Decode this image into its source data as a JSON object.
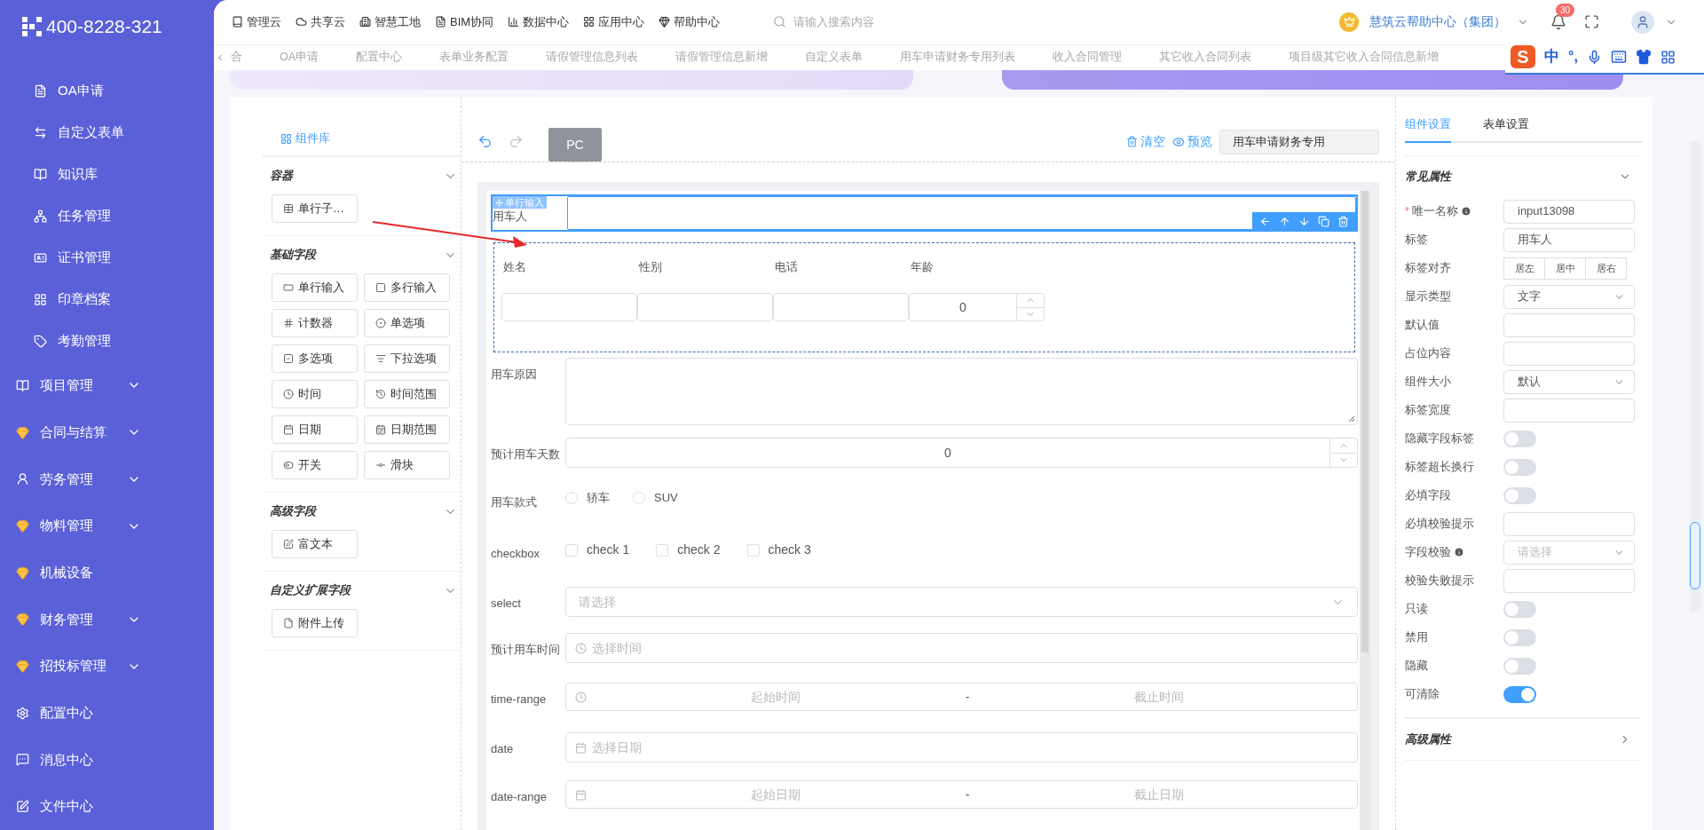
{
  "header": {
    "phone": "400-8228-321",
    "nav": [
      {
        "label": "管理云",
        "kind": "book"
      },
      {
        "label": "共享云",
        "kind": "cloud"
      },
      {
        "label": "智慧工地",
        "kind": "building"
      },
      {
        "label": "BIM协同",
        "kind": "doc"
      },
      {
        "label": "数据中心",
        "kind": "chart"
      },
      {
        "label": "应用中心",
        "kind": "apps"
      },
      {
        "label": "帮助中心",
        "kind": "gem"
      }
    ],
    "search": {
      "placeholder": "请输入搜索内容"
    },
    "org": "慧筑云帮助中心（集团）",
    "notifications": "30"
  },
  "tabs": [
    {
      "label": "合",
      "selected": false
    },
    {
      "label": "OA申请",
      "selected": false
    },
    {
      "label": "配置中心",
      "selected": false
    },
    {
      "label": "表单业务配置",
      "selected": false
    },
    {
      "label": "请假管理信息列表",
      "selected": false
    },
    {
      "label": "请假管理信息新增",
      "selected": false
    },
    {
      "label": "自定义表单",
      "selected": false
    },
    {
      "label": "用车申请财务专用列表",
      "selected": false
    },
    {
      "label": "收入合同管理",
      "selected": false
    },
    {
      "label": "其它收入合同列表",
      "selected": false
    },
    {
      "label": "项目级其它收入合同信息新增",
      "selected": false
    }
  ],
  "ime_bar": {
    "logo": "S",
    "mode": "中",
    "punct": "°,"
  },
  "sidebar": {
    "sub_items": [
      {
        "label": "OA申请",
        "kind": "file"
      },
      {
        "label": "自定义表单",
        "kind": "swap"
      },
      {
        "label": "知识库",
        "kind": "book"
      },
      {
        "label": "任务管理",
        "kind": "tree"
      },
      {
        "label": "证书管理",
        "kind": "card"
      },
      {
        "label": "印章档案",
        "kind": "grid"
      },
      {
        "label": "考勤管理",
        "kind": "tag"
      }
    ],
    "items": [
      {
        "label": "项目管理",
        "kind": "book",
        "expandable": true
      },
      {
        "label": "合同与结算",
        "kind": "gem",
        "expandable": true
      },
      {
        "label": "劳务管理",
        "kind": "user",
        "expandable": true
      },
      {
        "label": "物料管理",
        "kind": "gem",
        "expandable": true
      },
      {
        "label": "机械设备",
        "kind": "gem",
        "expandable": false
      },
      {
        "label": "财务管理",
        "kind": "gem",
        "expandable": true
      },
      {
        "label": "招投标管理",
        "kind": "gem",
        "expandable": true
      },
      {
        "label": "配置中心",
        "kind": "gear",
        "expandable": false
      },
      {
        "label": "消息中心",
        "kind": "chat",
        "expandable": false
      },
      {
        "label": "文件中心",
        "kind": "edit",
        "expandable": false
      }
    ]
  },
  "library": {
    "title": "组件库",
    "groups": [
      {
        "title": "容器",
        "expanded": true,
        "components": [
          {
            "label": "单行子…",
            "kind": "grid"
          }
        ]
      },
      {
        "title": "基础字段",
        "expanded": true,
        "components": [
          {
            "label": "单行输入",
            "kind": "input"
          },
          {
            "label": "多行输入",
            "kind": "textarea"
          },
          {
            "label": "计数器",
            "kind": "number"
          },
          {
            "label": "单选项",
            "kind": "radio"
          },
          {
            "label": "多选项",
            "kind": "checkbox"
          },
          {
            "label": "下拉选项",
            "kind": "select"
          },
          {
            "label": "时间",
            "kind": "time"
          },
          {
            "label": "时间范围",
            "kind": "time-range"
          },
          {
            "label": "日期",
            "kind": "date"
          },
          {
            "label": "日期范围",
            "kind": "date-range"
          },
          {
            "label": "开关",
            "kind": "switch"
          },
          {
            "label": "滑块",
            "kind": "slider"
          }
        ]
      },
      {
        "title": "高级字段",
        "expanded": true,
        "components": [
          {
            "label": "富文本",
            "kind": "richtext"
          }
        ]
      },
      {
        "title": "自定义扩展字段",
        "expanded": true,
        "components": [
          {
            "label": "附件上传",
            "kind": "upload"
          }
        ]
      }
    ]
  },
  "canvas": {
    "device": "PC",
    "clear": "清空",
    "preview": "预览",
    "form_name": "用车申请财务专用",
    "selected_tag": "单行输入",
    "fields": [
      {
        "kind": "input",
        "label": "用车人",
        "selected": true
      },
      {
        "kind": "grid",
        "selected": false,
        "columns": [
          {
            "label": "姓名",
            "kind": "input"
          },
          {
            "label": "性别",
            "kind": "input"
          },
          {
            "label": "电话",
            "kind": "input"
          },
          {
            "label": "年龄",
            "kind": "number",
            "value": "0"
          }
        ]
      },
      {
        "kind": "textarea",
        "label": "用车原因",
        "selected": false
      },
      {
        "kind": "number",
        "label": "预计用车天数",
        "value": "0",
        "selected": false
      },
      {
        "kind": "radio",
        "label": "用车款式",
        "selected": false,
        "options": [
          {
            "label": "轿车",
            "selected": false
          },
          {
            "label": "SUV",
            "selected": false
          }
        ]
      },
      {
        "kind": "checkbox",
        "label": "checkbox",
        "selected": false,
        "options": [
          {
            "label": "check 1",
            "checked": false
          },
          {
            "label": "check 2",
            "checked": false
          },
          {
            "label": "check 3",
            "checked": false
          }
        ]
      },
      {
        "kind": "select",
        "label": "select",
        "placeholder": "请选择",
        "selected": false
      },
      {
        "kind": "time",
        "label": "预计用车时间",
        "placeholder": "选择时间",
        "selected": false
      },
      {
        "kind": "time-range",
        "label": "time-range",
        "start": "起始时间",
        "separator": "-",
        "end": "截止时间",
        "selected": false
      },
      {
        "kind": "date",
        "label": "date",
        "placeholder": "选择日期",
        "selected": false
      },
      {
        "kind": "date-range",
        "label": "date-range",
        "start": "起始日期",
        "separator": "-",
        "end": "截止日期",
        "selected": false
      }
    ]
  },
  "settings": {
    "tabs": [
      {
        "label": "组件设置",
        "selected": true
      },
      {
        "label": "表单设置",
        "selected": false
      }
    ],
    "sections": [
      {
        "title": "常见属性",
        "expanded": true,
        "rows": [
          {
            "label": "唯一名称",
            "required_mark": "*",
            "info": true,
            "kind": "input",
            "value": "input13098"
          },
          {
            "label": "标签",
            "info": false,
            "kind": "input",
            "value": "用车人"
          },
          {
            "label": "标签对齐",
            "info": false,
            "kind": "segmented",
            "options": [
              {
                "label": "居左",
                "selected": false
              },
              {
                "label": "居中",
                "selected": false
              },
              {
                "label": "居右",
                "selected": false
              }
            ]
          },
          {
            "label": "显示类型",
            "info": false,
            "kind": "select",
            "value": "文字"
          },
          {
            "label": "默认值",
            "info": false,
            "kind": "input"
          },
          {
            "label": "占位内容",
            "info": false,
            "kind": "input"
          },
          {
            "label": "组件大小",
            "info": false,
            "kind": "select",
            "value": "默认"
          },
          {
            "label": "标签宽度",
            "info": false,
            "kind": "input"
          },
          {
            "label": "隐藏字段标签",
            "info": false,
            "kind": "switch",
            "on": false
          },
          {
            "label": "标签超长换行",
            "info": false,
            "kind": "switch",
            "on": false
          },
          {
            "label": "必填字段",
            "info": false,
            "kind": "switch",
            "on": false
          },
          {
            "label": "必填校验提示",
            "info": false,
            "kind": "input"
          },
          {
            "label": "字段校验",
            "info": true,
            "kind": "select",
            "placeholder": "请选择"
          },
          {
            "label": "校验失败提示",
            "info": false,
            "kind": "input"
          },
          {
            "label": "只读",
            "info": false,
            "kind": "switch",
            "on": false
          },
          {
            "label": "禁用",
            "info": false,
            "kind": "switch",
            "on": false
          },
          {
            "label": "隐藏",
            "info": false,
            "kind": "switch",
            "on": false
          },
          {
            "label": "可清除",
            "info": false,
            "kind": "switch",
            "on": true
          }
        ]
      },
      {
        "title": "高级属性",
        "expanded": false
      }
    ]
  }
}
